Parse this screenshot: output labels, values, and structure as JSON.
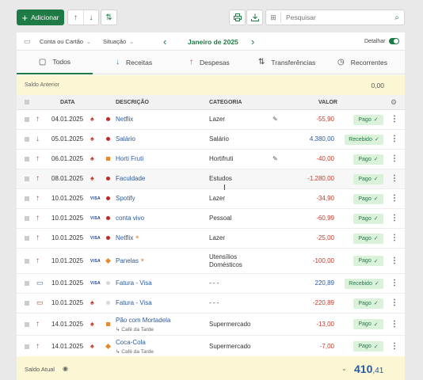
{
  "toolbar": {
    "add_label": "Adicionar",
    "search_placeholder": "Pesquisar"
  },
  "filters": {
    "account": "Conta ou Cartão",
    "situation": "Situação",
    "month": "Janeiro de 2025",
    "detail": "Detalhar"
  },
  "tabs": [
    {
      "label": "Todos"
    },
    {
      "label": "Receitas"
    },
    {
      "label": "Despesas"
    },
    {
      "label": "Transferências"
    },
    {
      "label": "Recorrentes"
    }
  ],
  "saldo_anterior": {
    "label": "Saldo Anterior",
    "value": "0,00"
  },
  "columns": {
    "data": "DATA",
    "descricao": "DESCRIÇÃO",
    "categoria": "CATEGORIA",
    "valor": "VALOR"
  },
  "rows": [
    {
      "date": "04.01.2025",
      "desc": "Netflix",
      "category": "Lazer",
      "value": "-55,90",
      "status": "Pago"
    },
    {
      "date": "05.01.2025",
      "desc": "Salário",
      "category": "Salário",
      "value": "4.380,00",
      "status": "Recebido"
    },
    {
      "date": "06.01.2025",
      "desc": "Horti Fruti",
      "category": "Hortifruti",
      "value": "-40,00",
      "status": "Pago"
    },
    {
      "date": "08.01.2025",
      "desc": "Faculdade",
      "category": "Estudos",
      "value": "-1.280,00",
      "status": "Pago"
    },
    {
      "date": "10.01.2025",
      "desc": "Spotify",
      "category": "Lazer",
      "value": "-34,90",
      "status": "Pago"
    },
    {
      "date": "10.01.2025",
      "desc": "conta vivo",
      "category": "Pessoal",
      "value": "-60,99",
      "status": "Pago"
    },
    {
      "date": "10.01.2025",
      "desc": "Netflix",
      "category": "Lazer",
      "value": "-25,00",
      "status": "Pago"
    },
    {
      "date": "10.01.2025",
      "desc": "Panelas",
      "category": "Utensílios Domésticos",
      "value": "-100,00",
      "status": "Pago"
    },
    {
      "date": "10.01.2025",
      "desc": "Fatura - Visa",
      "category": "- - -",
      "value": "220,89",
      "status": "Recebido"
    },
    {
      "date": "10.01.2025",
      "desc": "Fatura - Visa",
      "category": "- - -",
      "value": "-220,89",
      "status": "Pago"
    },
    {
      "date": "14.01.2025",
      "desc": "Pão com Mortadela",
      "sub": "Café da Tarde",
      "category": "Supermercado",
      "value": "-13,00",
      "status": "Pago"
    },
    {
      "date": "14.01.2025",
      "desc": "Coca-Cola",
      "sub": "Café da Tarde",
      "category": "Supermercado",
      "value": "-7,00",
      "status": "Pago"
    }
  ],
  "footer": {
    "label": "Saldo Atual",
    "value_int": "410",
    "value_dec": ",41"
  },
  "colors": {
    "primary": "#1e7b45",
    "expense": "#c53a2a",
    "income": "#2c5aa0",
    "highlight": "#fbf7d5"
  }
}
